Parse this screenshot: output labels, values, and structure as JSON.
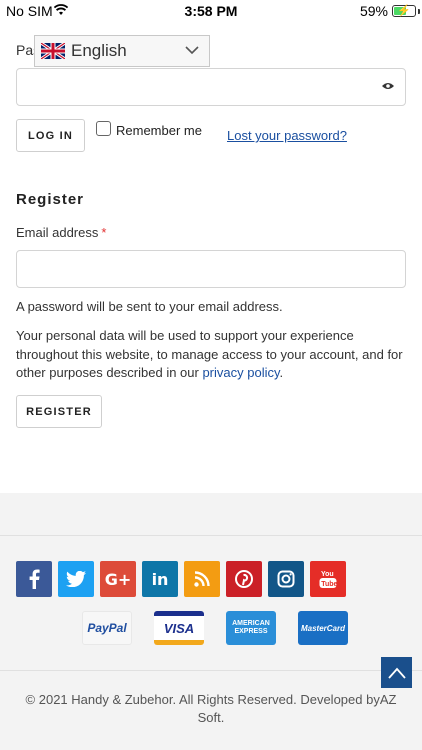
{
  "status_bar": {
    "carrier": "No SIM",
    "time": "3:58 PM",
    "battery_pct": "59%",
    "battery_level": 0.59
  },
  "language": {
    "selected": "English",
    "flag_icon": "uk-flag-icon"
  },
  "login": {
    "password_label_visible": "Pas",
    "login_button": "LOG IN",
    "remember_me": "Remember me",
    "lost_password": "Lost your password?"
  },
  "register": {
    "heading": "Register",
    "email_label": "Email address",
    "required_marker": "*",
    "password_note": "A password will be sent to your email address.",
    "privacy_text": "Your personal data will be used to support your experience throughout this website, to manage access to your account, and for other purposes described in our ",
    "privacy_link": "privacy policy",
    "privacy_end": ".",
    "register_button": "REGISTER"
  },
  "footer": {
    "socials": [
      {
        "name": "facebook-icon",
        "color": "#3b5998"
      },
      {
        "name": "twitter-icon",
        "color": "#1da1f2"
      },
      {
        "name": "google-plus-icon",
        "color": "#dd4b39"
      },
      {
        "name": "linkedin-icon",
        "color": "#0e76a8"
      },
      {
        "name": "rss-icon",
        "color": "#f39c12"
      },
      {
        "name": "pinterest-icon",
        "color": "#cb2027"
      },
      {
        "name": "instagram-icon",
        "color": "#125688"
      },
      {
        "name": "youtube-icon",
        "color": "#e52d27"
      }
    ],
    "payments": {
      "paypal": "PayPal",
      "visa": "VISA",
      "amex": "AMERICAN EXPRESS",
      "mastercard": "MasterCard"
    },
    "copyright": "© 2021 Handy & Zubehor. All Rights Reserved. Developed byAZ Soft.",
    "accent": "#1a4f8c"
  }
}
